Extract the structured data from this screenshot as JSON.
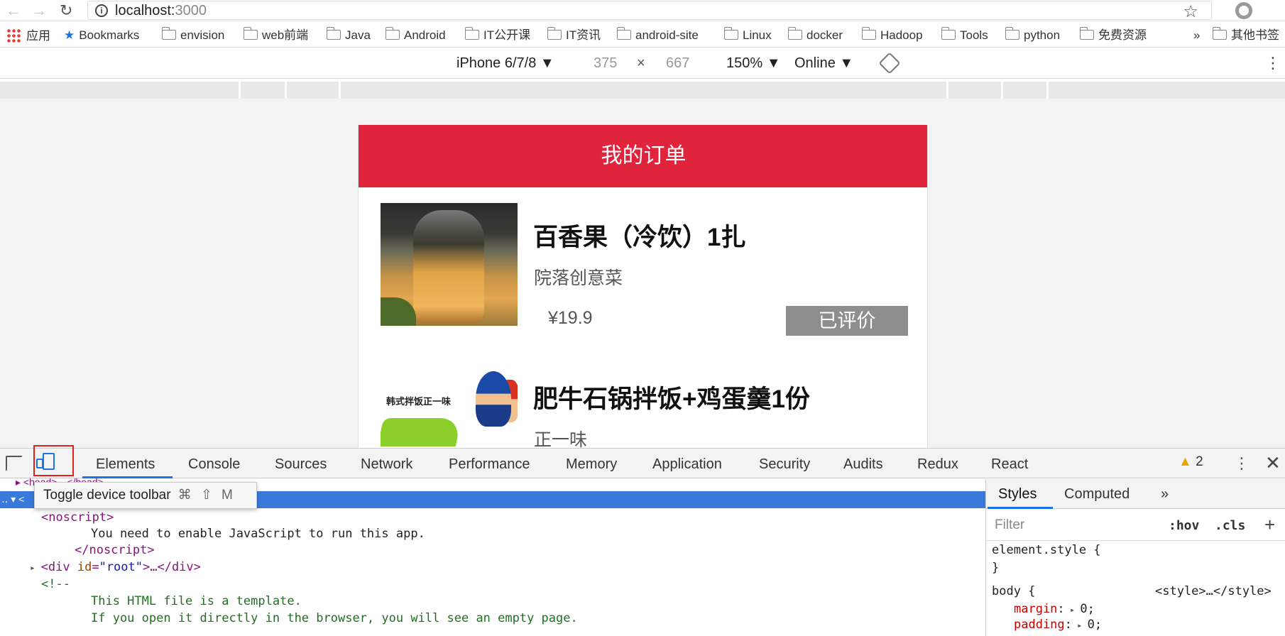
{
  "browser": {
    "url_host": "localhost:",
    "url_port": "3000",
    "bookmarks": [
      "应用",
      "Bookmarks",
      "envision",
      "web前端",
      "Java",
      "Android",
      "IT公开课",
      "IT资讯",
      "android-site",
      "Linux",
      "docker",
      "Hadoop",
      "Tools",
      "python",
      "免费资源"
    ],
    "overflow": "»",
    "other_bookmarks": "其他书签"
  },
  "device_toolbar": {
    "device": "iPhone 6/7/8 ▼",
    "width": "375",
    "times": "×",
    "height": "667",
    "zoom": "150% ▼",
    "network": "Online ▼"
  },
  "app": {
    "header_title": "我的订单",
    "orders": [
      {
        "title": "百香果（冷饮）1扎",
        "shop": "院落创意菜",
        "price": "¥19.9",
        "button": "已评价"
      },
      {
        "title": "肥牛石锅拌饭+鸡蛋羹1份",
        "shop": "正一味",
        "image_text": "韩式拌饭正一味"
      }
    ]
  },
  "devtools": {
    "tabs": [
      "Elements",
      "Console",
      "Sources",
      "Network",
      "Performance",
      "Memory",
      "Application",
      "Security",
      "Audits",
      "Redux",
      "React"
    ],
    "active_tab": "Elements",
    "warning_count": "2",
    "tooltip": {
      "label": "Toggle device toolbar",
      "shortcut": "⌘ ⇧ M"
    },
    "code": {
      "head_line": "<head>…</head>",
      "noscript_open": "<noscript>",
      "noscript_text": "You need to enable JavaScript to run this app.",
      "noscript_close": "</noscript>",
      "div_open": "<div ",
      "div_attr_name": "id",
      "div_attr_value": "\"root\"",
      "div_rest": ">…</div>",
      "comment_open": "<!--",
      "comment_1": "This HTML file is a template.",
      "comment_2": "If you open it directly in the browser, you will see an empty page."
    },
    "styles": {
      "tabs": [
        "Styles",
        "Computed",
        "»"
      ],
      "filter_placeholder": "Filter",
      "hov": ":hov",
      "cls": ".cls",
      "plus": "+",
      "element_style": "element.style {",
      "close_brace": "}",
      "body_selector": "body {",
      "source": "<style>…</style>",
      "rules": [
        {
          "prop": "margin",
          "val": "0;"
        },
        {
          "prop": "padding",
          "val": "0;"
        }
      ]
    }
  }
}
